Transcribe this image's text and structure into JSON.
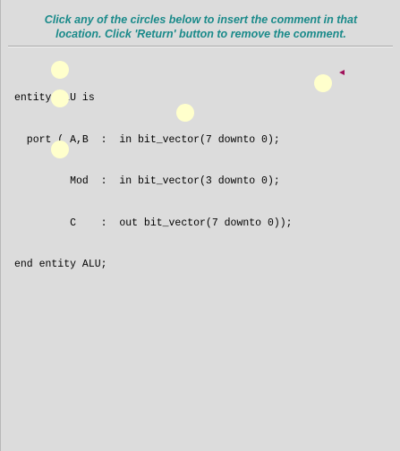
{
  "instructions": {
    "line1": "Click any of the circles below to insert the comment in that",
    "line2": "location. Click 'Return' button to remove the comment."
  },
  "code": {
    "lines": [
      "entity ALU is",
      "  port ( A,B  :  in bit_vector(7 downto 0);",
      "         Mod  :  in bit_vector(3 downto 0);",
      "         C    :  out bit_vector(7 downto 0));",
      "end entity ALU;"
    ]
  },
  "colors": {
    "instructions_text": "#1a8a8a",
    "circle_fill": "#ffffcc",
    "background": "#dcdcdc",
    "marker": "#a0105a"
  },
  "icons": {
    "marker": "return-marker-icon"
  }
}
